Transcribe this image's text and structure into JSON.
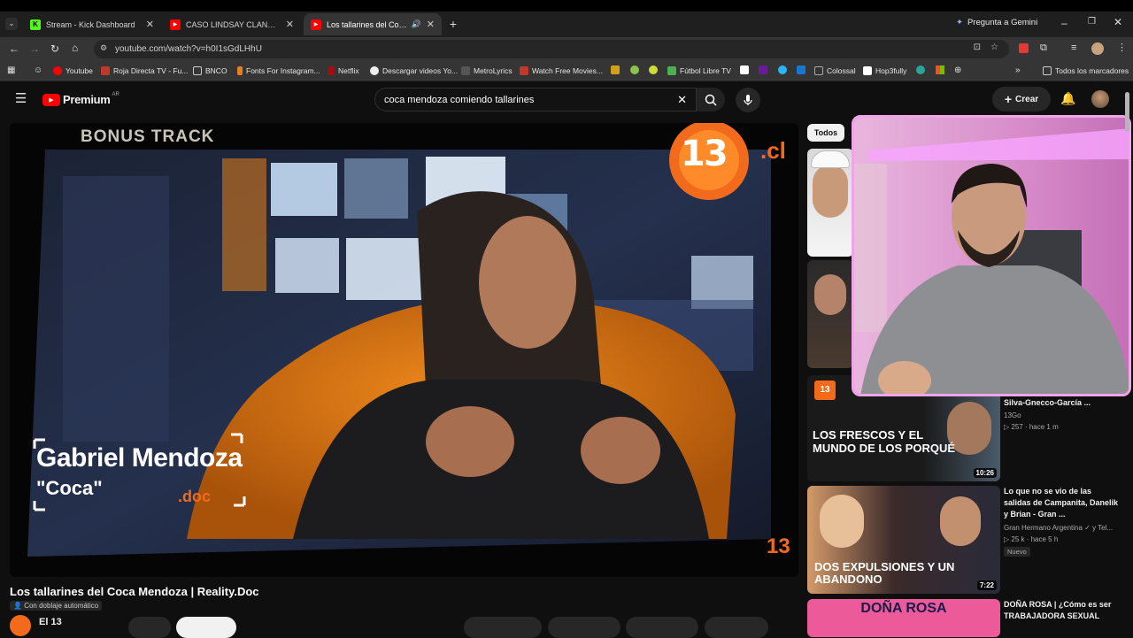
{
  "browser": {
    "tabs": [
      {
        "title": "Stream - Kick Dashboard",
        "active": false
      },
      {
        "title": "CASO LINDSAY CLANCY: ¿Colap",
        "active": false
      },
      {
        "title": "Los tallarines del Coca Men",
        "active": true
      }
    ],
    "gemini": "Pregunta a Gemini",
    "url": "youtube.com/watch?v=h0I1sGdLHhU",
    "bookmarks": [
      "Youtube",
      "Roja Directa TV - Fu...",
      "BNCO",
      "Fonts For Instagram...",
      "Netflix",
      "Descargar videos Yo...",
      "MetroLyrics",
      "Watch Free Movies...",
      "Fútbol Libre TV",
      "Colossal",
      "Hop3fully",
      "Todos los marcadores"
    ]
  },
  "youtube": {
    "logo": "Premium",
    "country": "AR",
    "search_value": "coca mendoza comiendo tallarines",
    "create_label": "Crear"
  },
  "video": {
    "overlay_bonus": "BONUS TRACK",
    "overlay_logo": "13",
    "overlay_logo_suffix": ".cl",
    "overlay_name": "Gabriel Mendoza",
    "overlay_nick": "\"Coca\"",
    "overlay_doc": ".doc",
    "title": "Los tallarines del Coca Mendoza | Reality.Doc",
    "dub_label": "Con doblaje automático",
    "channel": "El 13"
  },
  "sidebar": {
    "chip": "Todos",
    "items": [
      {
        "title": "Silva-Gnecco-García ...",
        "channel": "13Go",
        "stats": "▷ 257 · hace 1 m",
        "duration": "10:26",
        "thumb_text": "LOS FRESCOS Y EL MUNDO DE LOS PORQUÉ"
      },
      {
        "title": "Lo que no se vio de las salidas de Campanita, Danelik y Brian - Gran ...",
        "channel": "Gran Hermano Argentina ✓ y Tel...",
        "stats": "▷ 25 k · hace 5 h",
        "badge": "Nuevo",
        "duration": "7:22",
        "thumb_text": "DOS EXPULSIONES Y UN ABANDONO"
      },
      {
        "title": "DOÑA ROSA | ¿Cómo es ser TRABAJADORA SEXUAL",
        "thumb_text": "DOÑA ROSA"
      }
    ]
  }
}
